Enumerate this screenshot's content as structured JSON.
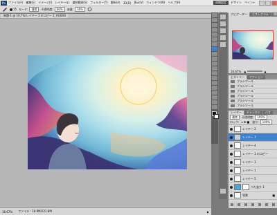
{
  "app": {
    "logo": "Ps"
  },
  "menu": [
    "ファイル(F)",
    "編集(E)",
    "イメージ(I)",
    "レイヤー(L)",
    "選択範囲(S)",
    "フィルター(T)",
    "解析(A)",
    "3D(D)",
    "表示(V)",
    "ウィンドウ(W)",
    "ヘルプ(H)"
  ],
  "workspace": {
    "essential": "初期設定",
    "design": "デザイン",
    "painting": "ペイント"
  },
  "options": {
    "brush_size": "15",
    "mode_label": "モード:",
    "mode": "通常",
    "opacity_label": "不透明度:",
    "opacity": "60%",
    "flow_label": "流量:",
    "flow": "30%"
  },
  "document": {
    "tab": "無題-1 @ 16.7%(レイヤー 3 のコピー 2, RGB/8)"
  },
  "status": {
    "zoom": "16.67%",
    "info": "ファイル：18.9M/221.8M"
  },
  "navigator": {
    "tabs": [
      "ナビゲーター",
      "ヒストグラム",
      "情報"
    ],
    "zoom": "16.67%"
  },
  "history": {
    "tabs": [
      "ヒストリー",
      "アクション"
    ],
    "items": [
      "ブラシツール",
      "ブラシツール",
      "ブラシツール",
      "ブラシツール",
      "ブラシツール",
      "ブラシツール",
      "ブラシツール",
      "ブラシツール"
    ],
    "selected_index": 7
  },
  "layers": {
    "tabs": [
      "レイヤー",
      "チャンネル",
      "パス"
    ],
    "mode": "通常",
    "opacity_label": "不透明度:",
    "opacity": "100%",
    "lock_label": "ロック:",
    "fill_label": "塗り:",
    "fill": "100%",
    "items": [
      "レイヤー 2",
      "レイヤー 7",
      "レイヤー 4",
      "レイヤー 3 のコピー",
      "レイヤー 3",
      "レイヤー 1",
      "レイヤー 5",
      "べた塗り 1",
      "背景"
    ],
    "selected_index": 1
  },
  "colors": {
    "accent": "#3b82d1",
    "panel": "#d8d8d8",
    "canvas_bg": "#b7b7b7"
  }
}
